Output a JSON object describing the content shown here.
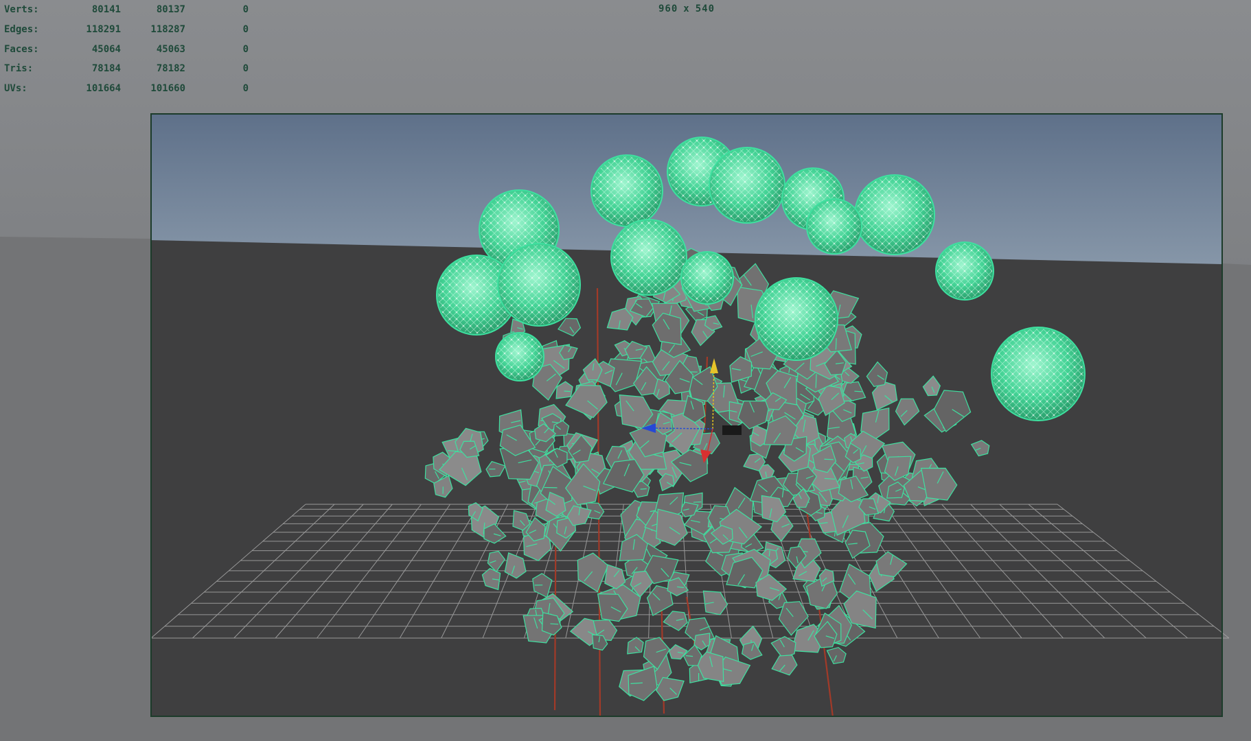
{
  "hud": {
    "rows": [
      {
        "label": "Verts:",
        "v1": "80141",
        "v2": "80137",
        "v3": "0"
      },
      {
        "label": "Edges:",
        "v1": "118291",
        "v2": "118287",
        "v3": "0"
      },
      {
        "label": "Faces:",
        "v1": "45064",
        "v2": "45063",
        "v3": "0"
      },
      {
        "label": "Tris:",
        "v1": "78184",
        "v2": "78182",
        "v3": "0"
      },
      {
        "label": "UVs:",
        "v1": "101664",
        "v2": "101660",
        "v3": "0"
      }
    ]
  },
  "resolution": {
    "width": "960",
    "sep": "x",
    "height": "540"
  },
  "colors": {
    "wireframe": "#3fe0a0",
    "leaf_fill": "#777777",
    "sky_top": "#5e7089",
    "floor": "#3e3e3e",
    "hud_text": "#1f4a3a"
  },
  "icons": {
    "manipulator": "move-manipulator-icon"
  }
}
